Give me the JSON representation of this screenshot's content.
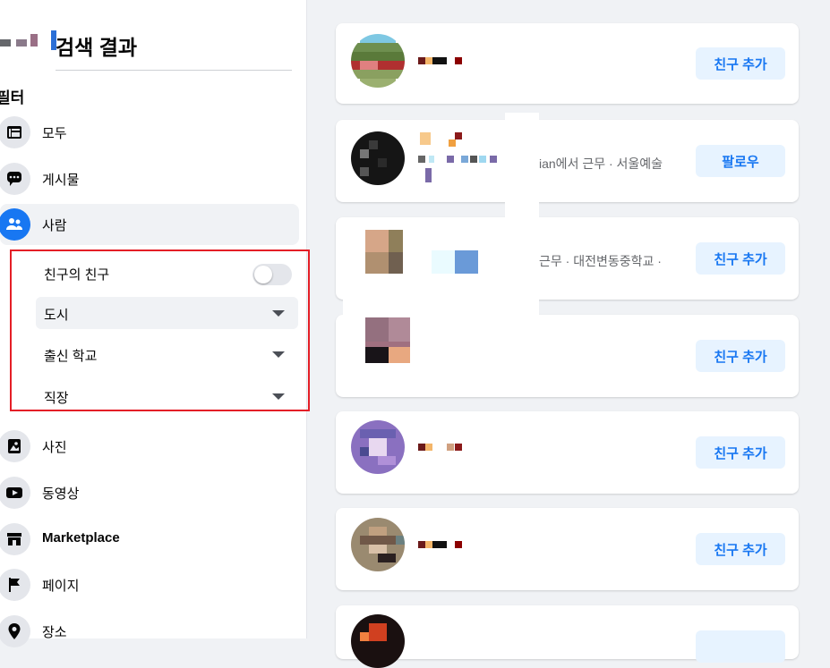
{
  "sidebar": {
    "title": "검색 결과",
    "filter_heading": "필터",
    "items": [
      {
        "label": "모두",
        "icon": "feed-icon"
      },
      {
        "label": "게시물",
        "icon": "chat-icon"
      },
      {
        "label": "사람",
        "icon": "people-icon"
      },
      {
        "label": "사진",
        "icon": "photo-icon"
      },
      {
        "label": "동영상",
        "icon": "video-icon"
      },
      {
        "label": "Marketplace",
        "icon": "shop-icon"
      },
      {
        "label": "페이지",
        "icon": "flag-icon"
      },
      {
        "label": "장소",
        "icon": "pin-icon"
      }
    ],
    "people_filters": {
      "friends_of_friends": "친구의 친구",
      "city": "도시",
      "education": "출신 학교",
      "work": "직장"
    }
  },
  "results": [
    {
      "meta": "",
      "action": "친구 추가"
    },
    {
      "meta": "ian에서 근무 · 서울예술",
      "action": "팔로우"
    },
    {
      "meta": "근무 · 대전변동중학교 ·",
      "action": "친구 추가"
    },
    {
      "meta": "",
      "action": "친구 추가"
    },
    {
      "meta": "",
      "action": "친구 추가"
    },
    {
      "meta": "",
      "action": "친구 추가"
    },
    {
      "meta": "",
      "action": ""
    }
  ],
  "colors": {
    "accent": "#1877f2",
    "highlight_box": "#e41e26",
    "button_bg": "#e7f3ff"
  }
}
